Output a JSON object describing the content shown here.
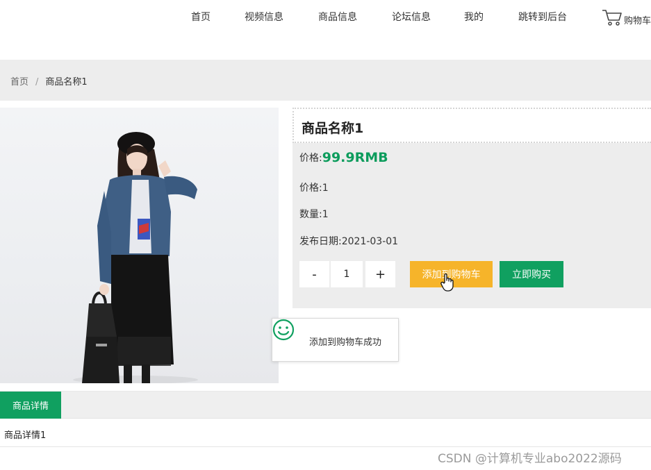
{
  "nav": {
    "items": [
      "首页",
      "视频信息",
      "商品信息",
      "论坛信息",
      "我的",
      "跳转到后台"
    ],
    "cart_label": "购物车"
  },
  "breadcrumb": {
    "home": "首页",
    "separator": "/",
    "current": "商品名称1"
  },
  "product": {
    "title": "商品名称1",
    "price_label": "价格:",
    "price_value": "99.9RMB",
    "price2_label": "价格:",
    "price2_value": "1",
    "quantity_label": "数量:",
    "quantity_value": "1",
    "date_label": "发布日期:",
    "date_value": "2021-03-01"
  },
  "stepper": {
    "minus": "-",
    "value": "1",
    "plus": "+"
  },
  "actions": {
    "add_to_cart": "添加到购物车",
    "buy_now": "立即购买"
  },
  "toast": {
    "message": "添加到购物车成功"
  },
  "details": {
    "tab_label": "商品详情",
    "content": "商品详情1"
  },
  "watermark": "CSDN @计算机专业abo2022源码",
  "colors": {
    "accent_green": "#10a060",
    "price_green": "#0c9c5c",
    "cart_button": "#f6b42a"
  }
}
